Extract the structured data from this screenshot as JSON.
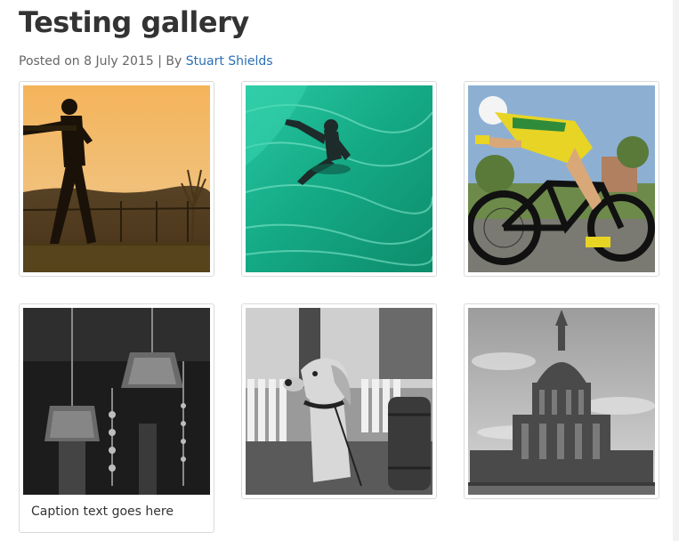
{
  "post": {
    "title": "Testing gallery",
    "posted_prefix": "Posted on",
    "date": "8 July 2015",
    "separator": "|",
    "by_prefix": "By",
    "author": "Stuart Shields"
  },
  "gallery": {
    "items": [
      {
        "subject": "cricket batsman silhouette at sunset",
        "caption": ""
      },
      {
        "subject": "bodyboarder in green wave",
        "caption": ""
      },
      {
        "subject": "time trial cyclist",
        "caption": ""
      },
      {
        "subject": "vintage lamps (black and white)",
        "caption": "Caption text goes here"
      },
      {
        "subject": "dog on porch (black and white)",
        "caption": ""
      },
      {
        "subject": "domed cathedral (black and white)",
        "caption": ""
      }
    ]
  },
  "colors": {
    "link": "#2a6fb5",
    "sunset": "#f2a548",
    "wave": "#1ab28b",
    "jersey": "#e8d424"
  }
}
